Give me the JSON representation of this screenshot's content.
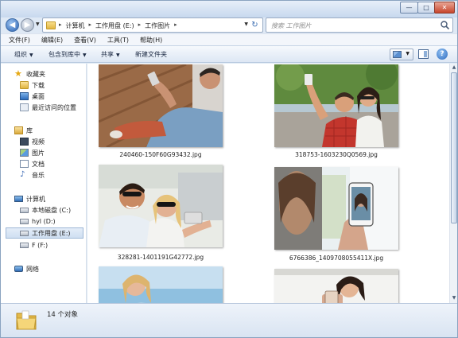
{
  "window": {
    "buttons": {
      "minimize": "—",
      "maximize": "□",
      "close": "✕"
    }
  },
  "nav": {
    "back_icon": "arrow-left-icon",
    "breadcrumbs": [
      "计算机",
      "工作用盘 (E:)",
      "工作图片"
    ],
    "search_placeholder": "搜索 工作图片"
  },
  "menu": [
    "文件(F)",
    "编辑(E)",
    "查看(V)",
    "工具(T)",
    "帮助(H)"
  ],
  "toolbar": {
    "organize": "组织",
    "include_library": "包含到库中",
    "share": "共享",
    "new_folder": "新建文件夹"
  },
  "sidebar": {
    "favorites": {
      "title": "收藏夹",
      "items": [
        "下载",
        "桌面",
        "最近访问的位置"
      ]
    },
    "libraries": {
      "title": "库",
      "items": [
        "视频",
        "图片",
        "文档",
        "音乐"
      ]
    },
    "computer": {
      "title": "计算机",
      "items": [
        "本地磁盘 (C:)",
        "hyl (D:)",
        "工作用盘 (E:)",
        "F (F:)"
      ],
      "selected": "工作用盘 (E:)"
    },
    "network": {
      "title": "网络"
    }
  },
  "files": [
    {
      "name": "240460-150F60G93432.jpg",
      "scene": "man-sitting-with-phone-on-wooden-deck"
    },
    {
      "name": "318753-1603230Q0569.jpg",
      "scene": "couple-taking-selfie-outdoors"
    },
    {
      "name": "328281-1401191G42772.jpg",
      "scene": "couple-in-sunglasses-taking-selfie"
    },
    {
      "name": "6766386_1409708055411X.jpg",
      "scene": "hand-holding-phone-showing-selfie"
    },
    {
      "name": "",
      "scene": "woman-on-beach-partial"
    },
    {
      "name": "",
      "scene": "woman-with-phone-partial"
    }
  ],
  "status": {
    "count_text": "14 个对象"
  },
  "colors": {
    "selection": "#cfdff2",
    "chrome": "#dfe9f5",
    "accent": "#2a62b2"
  }
}
